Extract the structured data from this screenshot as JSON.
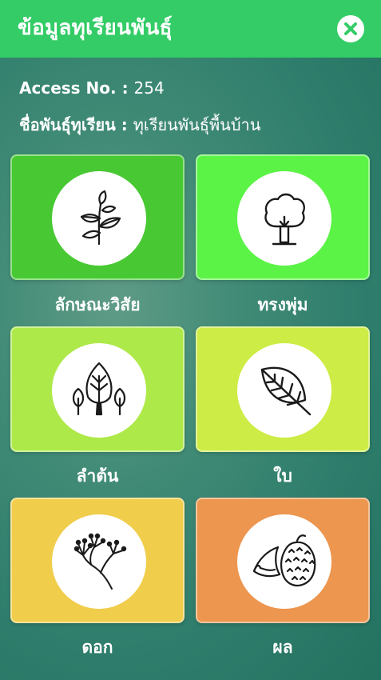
{
  "header": {
    "title": "ข้อมูลทุเรียนพันธุ์",
    "close_icon": "close-icon"
  },
  "info": {
    "access_label": "Access No.",
    "access_sep": " : ",
    "access_value": "254",
    "name_label": "ชื่อพันธุ์ทุเรียน",
    "name_sep": " : ",
    "name_value": "ทุเรียนพันธุ์พื้นบ้าน"
  },
  "categories": [
    {
      "label": "ลักษณะวิสัย",
      "icon": "plant-sprout-icon",
      "color": "#48c933"
    },
    {
      "label": "ทรงพุ่ม",
      "icon": "tree-canopy-icon",
      "color": "#5cf347"
    },
    {
      "label": "ลำต้น",
      "icon": "trees-trunk-icon",
      "color": "#aee94a"
    },
    {
      "label": "ใบ",
      "icon": "leaf-icon",
      "color": "#cdec45"
    },
    {
      "label": "ดอก",
      "icon": "flower-icon",
      "color": "#f0cd4b"
    },
    {
      "label": "ผล",
      "icon": "durian-fruit-icon",
      "color": "#ed964f"
    }
  ],
  "colors": {
    "header": "#33cc66",
    "close_x": "#33cc66"
  }
}
